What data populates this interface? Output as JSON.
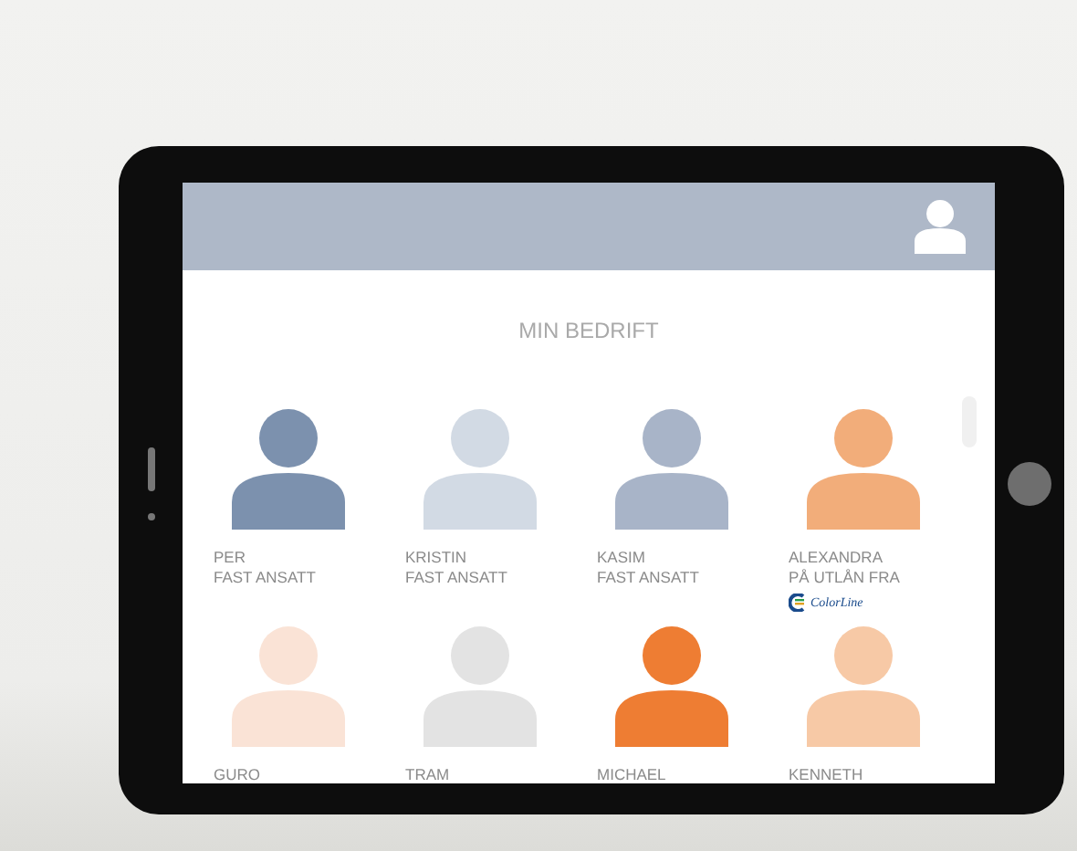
{
  "header": {
    "title": "MIN BEDRIFT"
  },
  "people": [
    {
      "name": "PER",
      "status": "FAST ANSATT",
      "color": "#7c91ae"
    },
    {
      "name": "KRISTIN",
      "status": "FAST ANSATT",
      "color": "#d2dae4"
    },
    {
      "name": "KASIM",
      "status": "FAST ANSATT",
      "color": "#a8b4c8"
    },
    {
      "name": "ALEXANDRA",
      "status": "PÅ UTLÅN FRA",
      "logo_text": "ColorLine",
      "color": "#f2ad7a"
    },
    {
      "name": "GURO",
      "color": "#fae3d6"
    },
    {
      "name": "TRAM",
      "color": "#e3e3e3"
    },
    {
      "name": "MICHAEL",
      "color": "#ee7d33"
    },
    {
      "name": "KENNETH",
      "color": "#f7c9a6"
    }
  ]
}
